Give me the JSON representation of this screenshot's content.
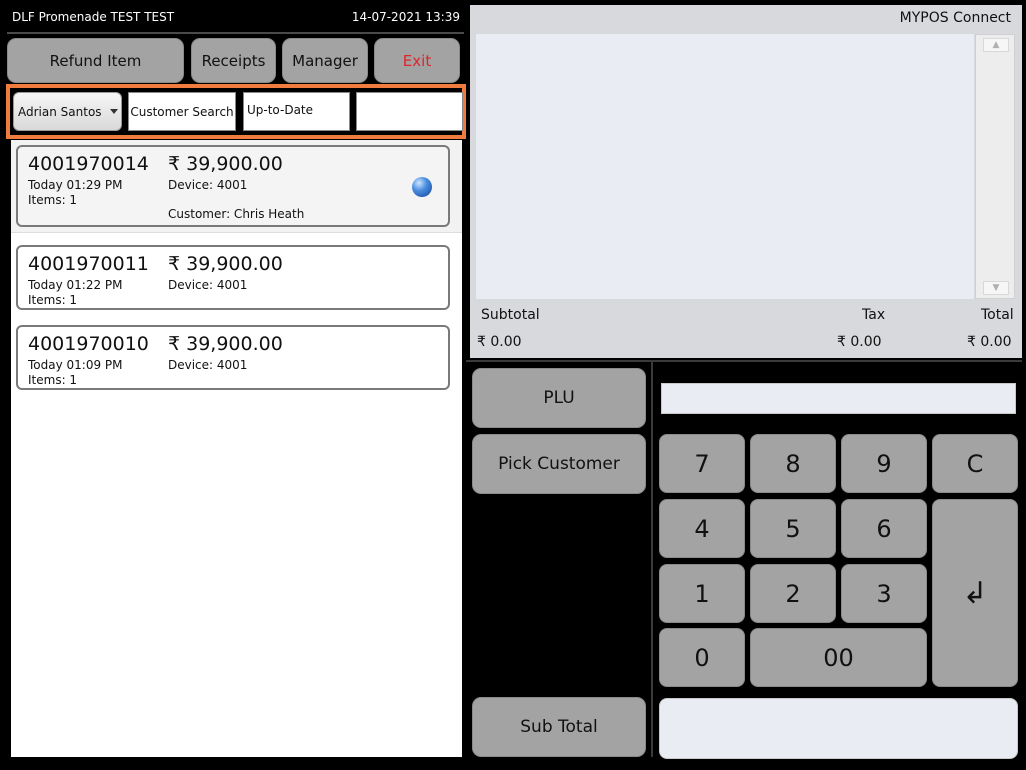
{
  "title_bar": {
    "store": "DLF Promenade TEST TEST",
    "datetime": "14-07-2021 13:39"
  },
  "toolbar": {
    "refund": "Refund Item",
    "receipts": "Receipts",
    "manager": "Manager",
    "exit": "Exit"
  },
  "filters": {
    "employee": "Adrian Santos",
    "customer_search": "Customer Search",
    "up_to_date": "Up-to-Date",
    "blank_value": ""
  },
  "receipts": [
    {
      "number": "4001970014",
      "amount": "₹ 39,900.00",
      "time": "Today 01:29 PM",
      "device": "Device: 4001",
      "items": "Items: 1",
      "customer": "Customer: Chris  Heath"
    },
    {
      "number": "4001970011",
      "amount": "₹ 39,900.00",
      "time": "Today 01:22 PM",
      "device": "Device: 4001",
      "items": "Items: 1"
    },
    {
      "number": "4001970010",
      "amount": "₹ 39,900.00",
      "time": "Today 01:09 PM",
      "device": "Device: 4001",
      "items": "Items: 1"
    }
  ],
  "receipt_panel": {
    "brand": "MYPOS Connect",
    "subtotal_label": "Subtotal",
    "tax_label": "Tax",
    "total_label": "Total",
    "subtotal": "₹ 0.00",
    "tax": "₹ 0.00",
    "total": "₹ 0.00"
  },
  "functions": {
    "plu": "PLU",
    "pick_customer": "Pick Customer",
    "sub_total": "Sub Total"
  },
  "keypad": {
    "k7": "7",
    "k8": "8",
    "k9": "9",
    "kc": "C",
    "k4": "4",
    "k5": "5",
    "k6": "6",
    "k1": "1",
    "k2": "2",
    "k3": "3",
    "k0": "0",
    "k00": "00",
    "enter": "↲"
  },
  "icons": {
    "dropdown": "chevron-down-icon",
    "selected": "blue-dot-icon",
    "scroll_up": "arrow-up-icon",
    "scroll_down": "arrow-down-icon"
  },
  "colors": {
    "highlight": "#f07d3e",
    "exit": "#e0242b",
    "button": "#a3a3a3"
  }
}
